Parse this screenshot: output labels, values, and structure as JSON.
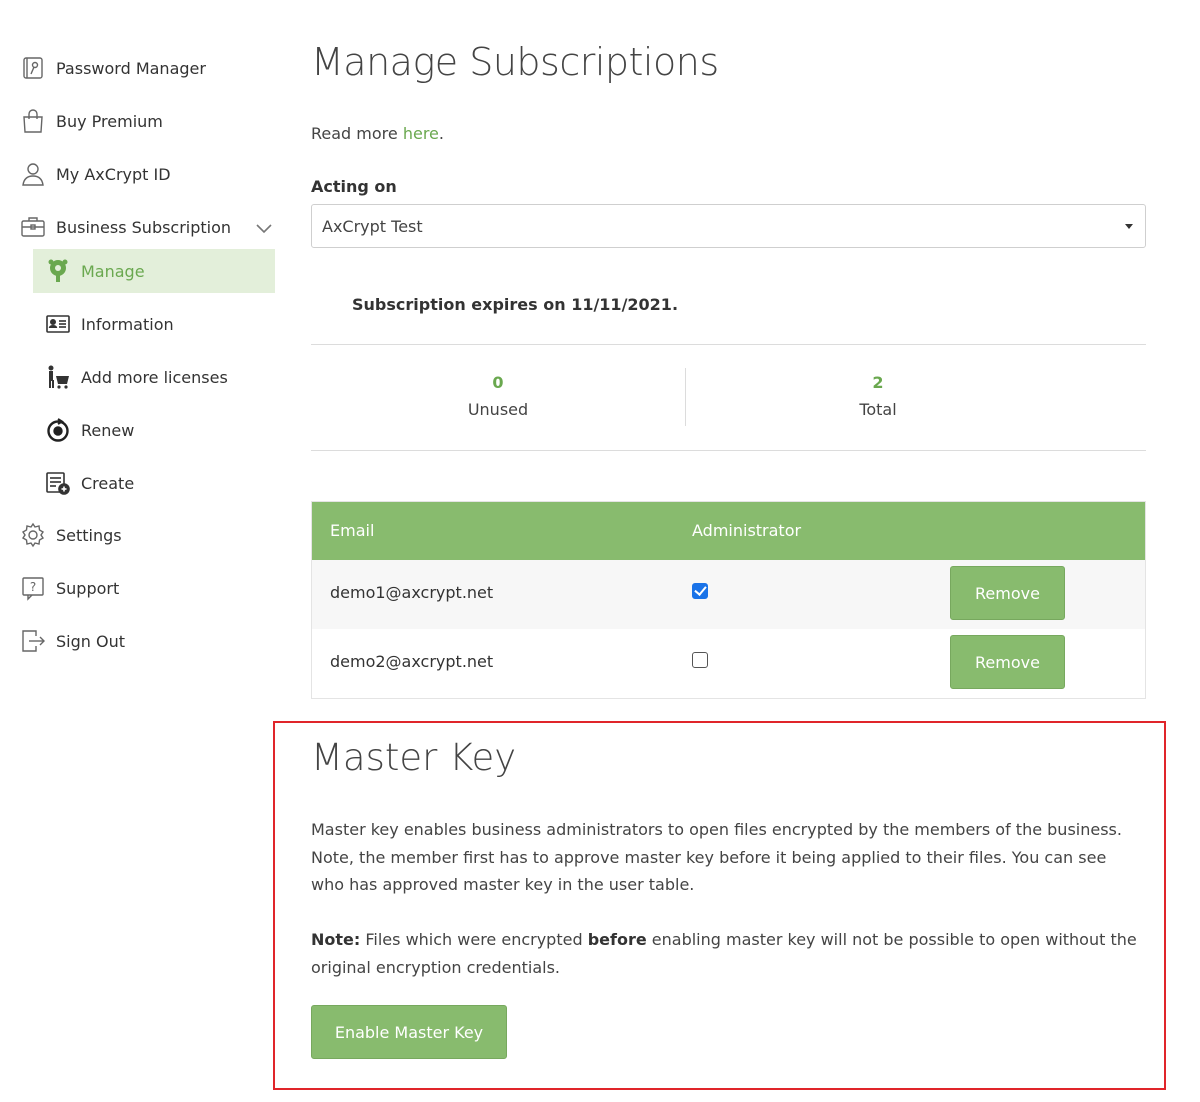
{
  "sidebar": {
    "items": [
      {
        "label": "Password Manager",
        "icon": "password-manager-icon"
      },
      {
        "label": "Buy Premium",
        "icon": "shopping-bag-icon"
      },
      {
        "label": "My AxCrypt ID",
        "icon": "user-icon"
      },
      {
        "label": "Business Subscription",
        "icon": "briefcase-icon"
      },
      {
        "label": "Settings",
        "icon": "gear-icon"
      },
      {
        "label": "Support",
        "icon": "help-icon"
      },
      {
        "label": "Sign Out",
        "icon": "sign-out-icon"
      }
    ],
    "sub_items": [
      {
        "label": "Manage",
        "icon": "manage-icon",
        "active": true
      },
      {
        "label": "Information",
        "icon": "id-card-icon"
      },
      {
        "label": "Add more licenses",
        "icon": "add-licenses-icon"
      },
      {
        "label": "Renew",
        "icon": "renew-icon"
      },
      {
        "label": "Create",
        "icon": "create-icon"
      }
    ]
  },
  "main": {
    "title": "Manage Subscriptions",
    "read_more_prefix": "Read more ",
    "read_more_link": "here",
    "read_more_suffix": ".",
    "acting_on_label": "Acting on",
    "acting_on_value": "AxCrypt Test",
    "expires_text": "Subscription expires on 11/11/2021.",
    "stats": [
      {
        "value": "0",
        "label": "Unused"
      },
      {
        "value": "2",
        "label": "Total"
      }
    ],
    "table": {
      "headers": [
        "Email",
        "Administrator"
      ],
      "rows": [
        {
          "email": "demo1@axcrypt.net",
          "admin": true,
          "action": "Remove"
        },
        {
          "email": "demo2@axcrypt.net",
          "admin": false,
          "action": "Remove"
        }
      ]
    }
  },
  "master_key": {
    "title": "Master Key",
    "description": "Master key enables business administrators to open files encrypted by the members of the business. Note, the member first has to approve master key before it being applied to their files. You can see who has approved master key in the user table.",
    "note_label": "Note:",
    "note_part1": " Files which were encrypted ",
    "note_bold": "before",
    "note_part2": " enabling master key will not be possible to open without the original encryption credentials.",
    "button": "Enable Master Key"
  },
  "colors": {
    "accent": "#88bb6e",
    "link": "#6aa84f",
    "highlight_border": "#e0252a",
    "active_bg": "#e3efda"
  }
}
